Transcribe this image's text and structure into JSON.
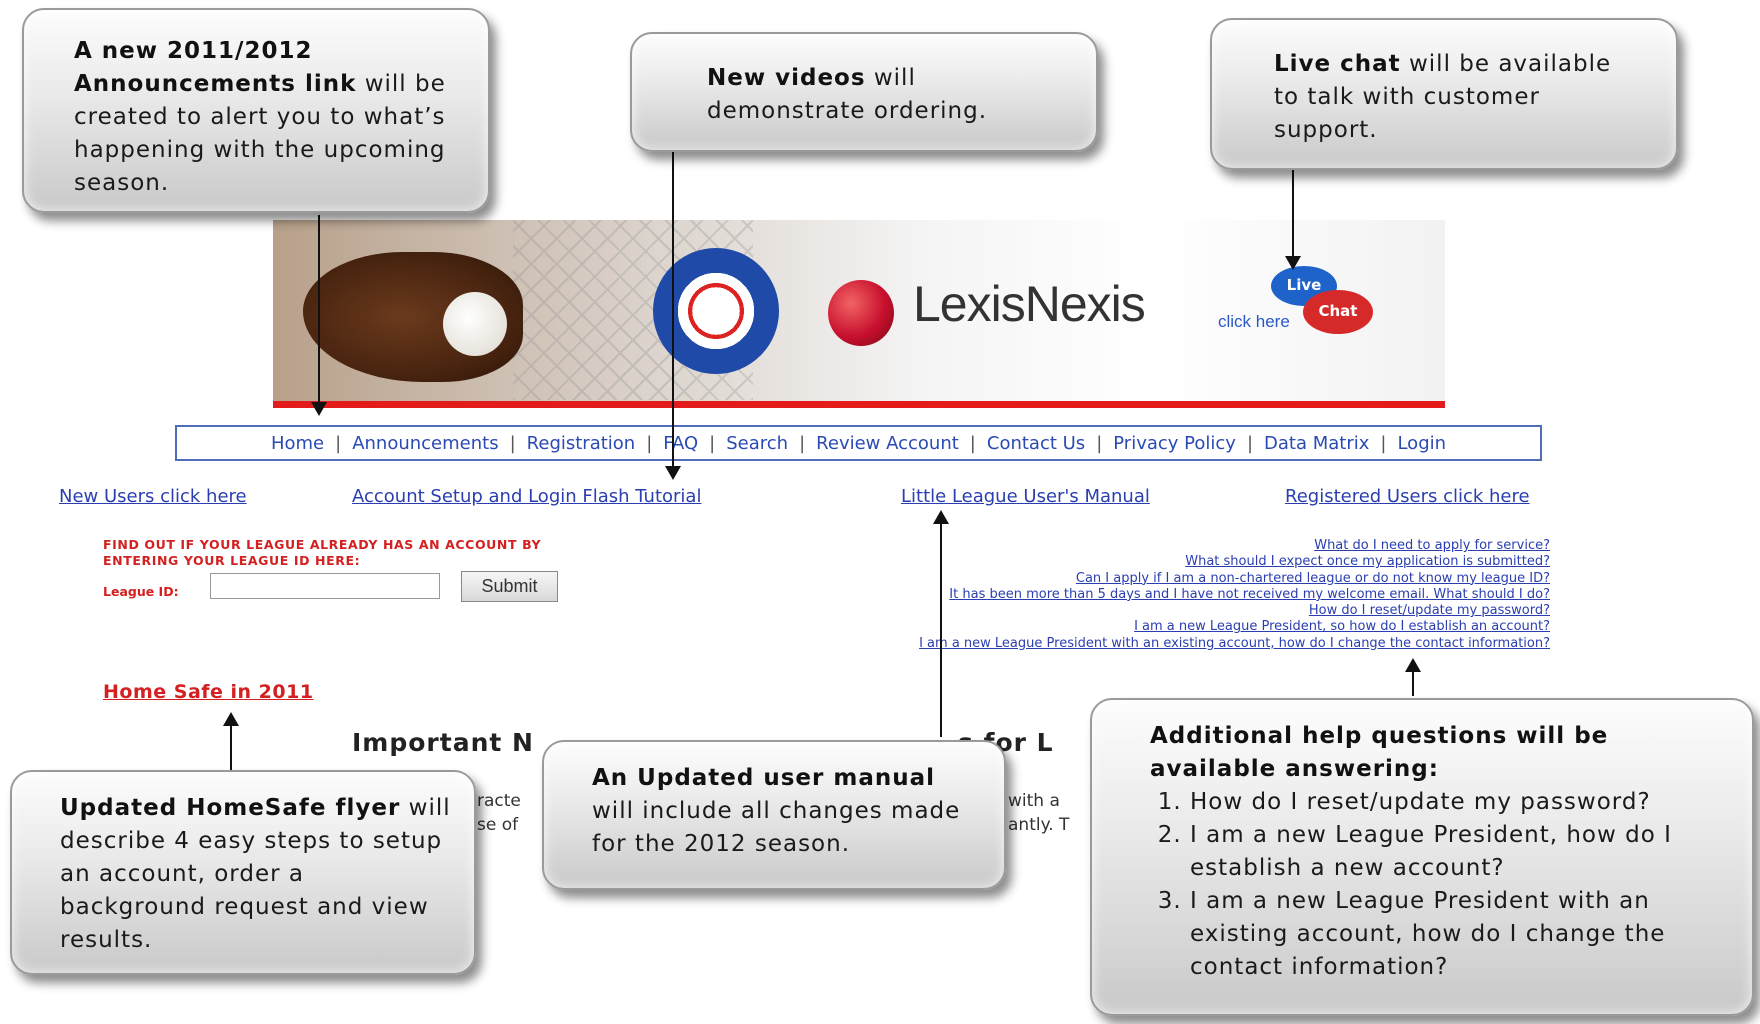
{
  "callouts": {
    "announcements": {
      "bold1": "A new 2011/2012",
      "bold2": "Announcements link",
      "rest": " will be created to alert you to what’s happening with the upcoming season."
    },
    "videos": {
      "bold": "New videos",
      "rest": " will demonstrate ordering."
    },
    "livechat": {
      "bold": "Live chat",
      "rest": " will be available to talk with customer support."
    },
    "homesafe": {
      "bold": "Updated HomeSafe flyer",
      "rest": " will describe 4 easy steps to setup an account, order a background request and view results."
    },
    "manual": {
      "bold": "An Updated user manual",
      "rest": " will include all changes made for the 2012 season."
    },
    "help": {
      "bold": "Additional help questions will be available answering:",
      "items": [
        "How do I reset/update my password?",
        "I am a new League President, how do I establish a new account?",
        "I am a new League President with an existing account, how do I change the contact information?"
      ]
    }
  },
  "banner": {
    "brand": "LexisNexis",
    "chat_live": "Live",
    "chat_chat": "Chat",
    "chat_click": "click here"
  },
  "nav": [
    "Home",
    "Announcements",
    "Registration",
    "FAQ",
    "Search",
    "Review Account",
    "Contact Us",
    "Privacy Policy",
    "Data Matrix",
    "Login"
  ],
  "links": {
    "new_users": "New Users click here",
    "tutorial": "Account Setup and Login Flash Tutorial",
    "manual": "Little League User's Manual",
    "registered": "Registered Users click here"
  },
  "league": {
    "find_line1": "FIND OUT IF YOUR LEAGUE ALREADY HAS AN ACCOUNT BY",
    "find_line2": "ENTERING YOUR LEAGUE ID HERE:",
    "id_label": "League ID:",
    "id_value": "",
    "submit": "Submit"
  },
  "faq": [
    "What do I need to apply for service?",
    "What should I expect once my application is submitted?",
    "Can I apply if I am a non-chartered league or do not know my league ID?",
    "It has been more than 5 days and I have not received my welcome email. What should I do?",
    "How do I reset/update my password?",
    "I am a new League President, so how do I establish an account?",
    "I am a new League President with an existing account, how do I change the contact information?"
  ],
  "homesafe_link": "Home Safe in 2011",
  "important_heading": "Important N",
  "important_tail": "s for L",
  "fragments": {
    "a1": "racte",
    "a2": "se of",
    "b1": "with a",
    "b2": "antly. T"
  }
}
